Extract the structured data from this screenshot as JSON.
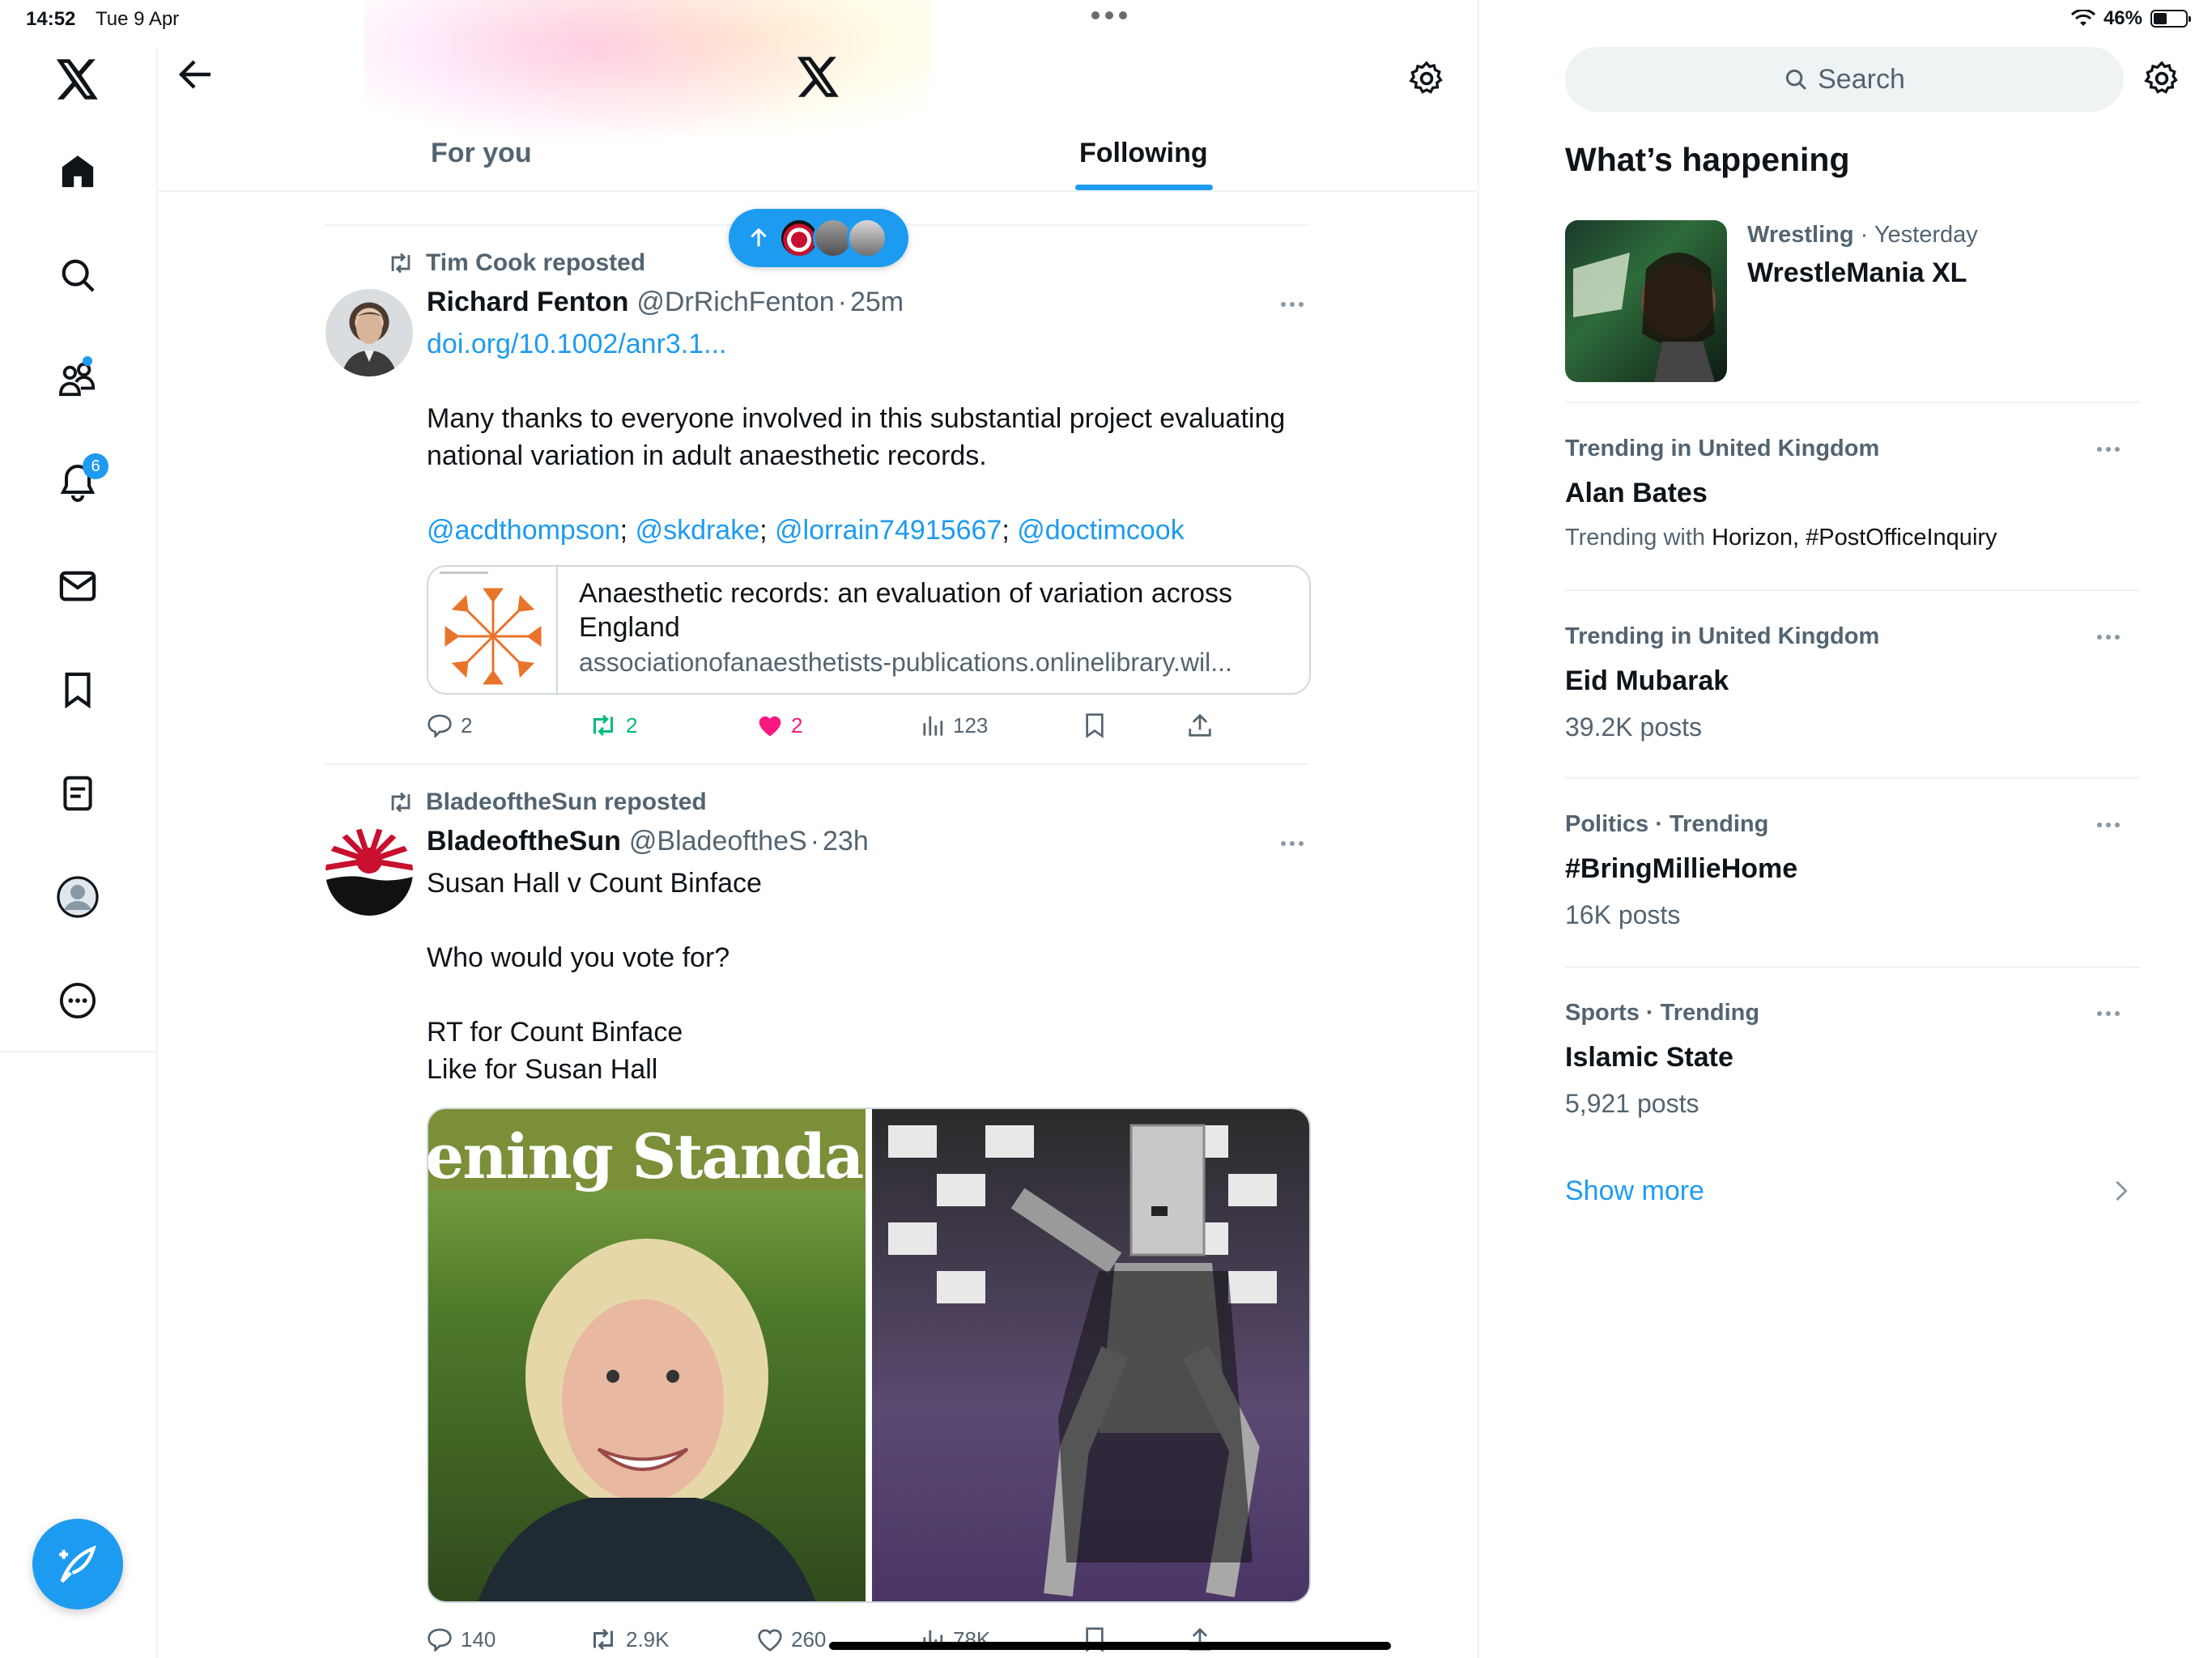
{
  "status_bar": {
    "time": "14:52",
    "date": "Tue 9 Apr",
    "battery": "46%",
    "battery_level": 0.46
  },
  "left_nav": {
    "items": [
      {
        "icon": "home-icon"
      },
      {
        "icon": "search-icon"
      },
      {
        "icon": "communities-icon"
      },
      {
        "icon": "notifications-icon",
        "badge": "6"
      },
      {
        "icon": "messages-icon"
      },
      {
        "icon": "bookmarks-icon"
      },
      {
        "icon": "lists-icon"
      },
      {
        "icon": "profile-icon"
      },
      {
        "icon": "more-icon"
      }
    ],
    "compose_icon": "compose-feather-icon"
  },
  "header": {
    "tabs": [
      {
        "label": "For you",
        "active": false
      },
      {
        "label": "Following",
        "active": true
      }
    ]
  },
  "tweets": [
    {
      "repost_label": "Tim Cook reposted",
      "author_name": "Richard Fenton",
      "handle": "@DrRichFenton",
      "dot": "·",
      "time": "25m",
      "link": "doi.org/10.1002/anr3.1...",
      "text": "Many thanks to everyone involved in this substantial project evaluating national variation in adult anaesthetic records.",
      "mentions": [
        "@acdthompson",
        "@skdrake",
        "@lorrain74915667",
        "@doctimcook"
      ],
      "mention_sep": ";",
      "card": {
        "title": "Anaesthetic records: an evaluation of variation across England",
        "domain": "associationofanaesthetists-publications.onlinelibrary.wil..."
      },
      "stats": {
        "replies": "2",
        "reposts": "2",
        "likes": "2",
        "views": "123"
      }
    },
    {
      "repost_label": "BladeoftheSun reposted",
      "author_name": "BladeoftheSun",
      "handle": "@BladeoftheS",
      "dot": "·",
      "time": "23h",
      "lines": [
        "Susan Hall v Count Binface",
        "",
        "Who would you vote for?",
        "",
        "RT for Count Binface",
        "Like for Susan Hall"
      ],
      "media_caption_left": "ening Standa",
      "stats": {
        "replies": "140",
        "reposts": "2.9K",
        "likes": "260",
        "views": "78K"
      }
    }
  ],
  "search": {
    "placeholder": "Search"
  },
  "whats_happening": {
    "title": "What’s happening",
    "featured": {
      "category": "Wrestling",
      "dot": "·",
      "when": "Yesterday",
      "name": "WrestleMania XL"
    },
    "trends": [
      {
        "category": "Trending in United Kingdom",
        "name": "Alan Bates",
        "with_prefix": "Trending with",
        "with_items": "Horizon, #PostOfficeInquiry"
      },
      {
        "category": "Trending in United Kingdom",
        "name": "Eid Mubarak",
        "posts": "39.2K posts"
      },
      {
        "category": "Politics · Trending",
        "name": "#BringMillieHome",
        "posts": "16K posts"
      },
      {
        "category": "Sports · Trending",
        "name": "Islamic State",
        "posts": "5,921 posts"
      }
    ],
    "show_more": "Show more"
  },
  "colors": {
    "accent": "#1d9bf0",
    "like": "#f91880",
    "repost": "#00ba7c",
    "muted": "#536471"
  }
}
